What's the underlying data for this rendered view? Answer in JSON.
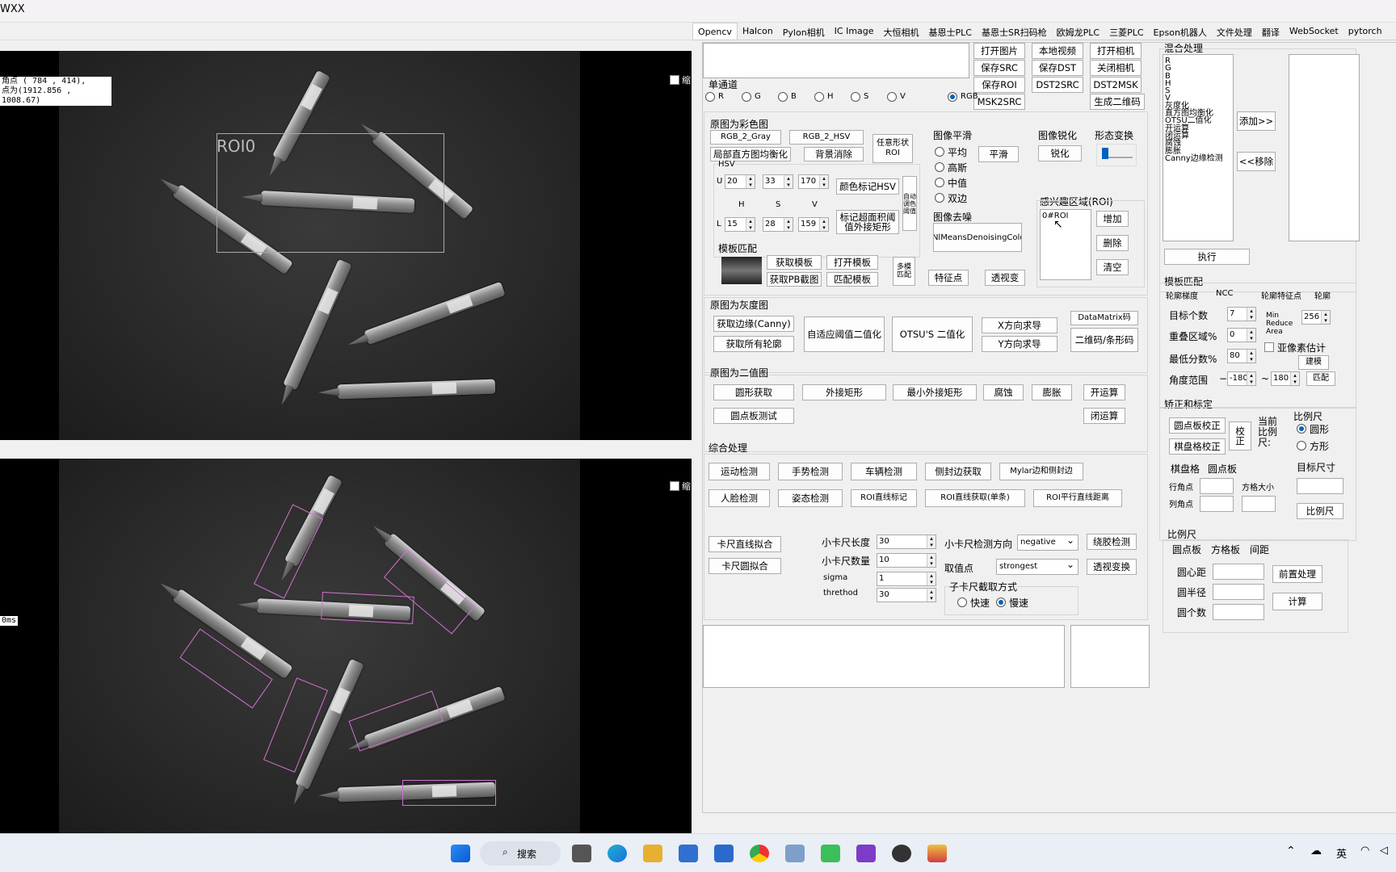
{
  "window": {
    "title": "WXX"
  },
  "left": {
    "top_view": {
      "overlay_lines": [
        "角点 ( 784 , 414),",
        "点为(1912.856 , 1008.67)"
      ],
      "roi_label": "ROI0",
      "checkbox_label": "缩"
    },
    "bottom_view": {
      "overlay_text": "0ms",
      "checkbox_label": "缩"
    }
  },
  "tabs": [
    "Opencv",
    "Halcon",
    "Pylon相机",
    "IC Image",
    "大恒相机",
    "基恩士PLC",
    "基恩士SR扫码枪",
    "欧姆龙PLC",
    "三菱PLC",
    "Epson机器人",
    "文件处理",
    "翻译",
    "WebSocket",
    "pytorch"
  ],
  "file_buttons": {
    "open_image": "打开图片",
    "local_video": "本地视频",
    "open_camera": "打开相机",
    "save_src": "保存SRC",
    "save_dst": "保存DST",
    "close_camera": "关闭相机",
    "save_roi": "保存ROI",
    "dst2src": "DST2SRC",
    "dst2msk": "DST2MSK",
    "msk2src": "MSK2SRC",
    "gen_qr": "生成二维码"
  },
  "channel": {
    "title": "单通道",
    "options": [
      "R",
      "G",
      "B",
      "H",
      "S",
      "V",
      "RGB"
    ],
    "selected": "RGB"
  },
  "color_section": {
    "title": "原图为彩色图",
    "rgb2gray": "RGB_2_Gray",
    "rgb2hsv": "RGB_2_HSV",
    "any_roi": "任意形状ROI",
    "local_hist": "局部直方图均衡化",
    "bg_remove": "背景消除",
    "hsv_title": "HSV",
    "u_label": "U",
    "l_label": "L",
    "h_label": "H",
    "s_label": "S",
    "v_label": "V",
    "u_vals": [
      "20",
      "33",
      "170"
    ],
    "l_vals": [
      "15",
      "28",
      "159"
    ],
    "color_mark": "颜色标记HSV",
    "mark_rect": "标记超面积阈值外接矩形",
    "vertical_btn": "自动调色阈值",
    "template_title": "模板匹配",
    "get_template": "获取模板",
    "open_template": "打开模板",
    "get_pb": "获取PB截图",
    "match_template": "匹配模板",
    "multi_match": "多模匹配",
    "smooth_title": "图像平滑",
    "smooth_opts": [
      "平均",
      "高斯",
      "中值",
      "双边"
    ],
    "smooth_btn": "平滑",
    "denoise_title": "图像去噪",
    "denoise_btn": "fastNlMeansDenoisingColored",
    "feature_pt": "特征点",
    "perspective": "透视变",
    "sharpen_title": "图像锐化",
    "sharpen_btn": "锐化",
    "morph_title": "形态变换",
    "roi_title": "感兴趣区域(ROI)",
    "roi_items": [
      "0#ROI"
    ],
    "roi_add": "增加",
    "roi_del": "删除",
    "roi_clear": "清空"
  },
  "gray_section": {
    "title": "原图为灰度图",
    "canny": "获取边缘(Canny)",
    "all_contours": "获取所有轮廓",
    "adaptive": "自适应阈值二值化",
    "otsu": "OTSU'S 二值化",
    "xderiv": "X方向求导",
    "yderiv": "Y方向求导",
    "datamatrix": "DataMatrix码",
    "qr_bar": "二维码/条形码"
  },
  "binary_section": {
    "title": "原图为二值图",
    "circle": "圆形获取",
    "bound_rect": "外接矩形",
    "min_rect": "最小外接矩形",
    "erode": "腐蚀",
    "dilate": "膨胀",
    "open": "开运算",
    "dot_test": "圆点板测试",
    "close": "闭运算"
  },
  "general": {
    "title": "综合处理",
    "motion": "运动检测",
    "gesture": "手势检测",
    "vehicle": "车辆检测",
    "side_seal": "侧封边获取",
    "mylar": "Mylar边和侧封边",
    "face": "人脸检测",
    "pose": "姿态检测",
    "roi_line": "ROI直线标记",
    "roi_line_single": "ROI直线获取(单条)",
    "roi_parallel": "ROI平行直线距离",
    "caliper_line": "卡尺直线拟合",
    "caliper_circle": "卡尺圆拟合",
    "cal_len_label": "小卡尺长度",
    "cal_len": "30",
    "cal_num_label": "小卡尺数量",
    "cal_num": "10",
    "sigma_label": "sigma",
    "sigma": "1",
    "thr_label": "threthod",
    "thr": "30",
    "dir_label": "小卡尺检测方向",
    "dir_val": "negative",
    "pick_label": "取值点",
    "pick_val": "strongest",
    "glue": "绕胶检测",
    "persp": "透视变换",
    "sub_title": "子卡尺截取方式",
    "fast": "快速",
    "slow": "慢速"
  },
  "mix": {
    "title": "混合处理",
    "list": [
      "R",
      "G",
      "B",
      "H",
      "S",
      "V",
      "灰度化",
      "直方图均衡化",
      "OTSU二值化",
      "开运算",
      "闭运算",
      "腐蚀",
      "膨胀",
      "Canny边缘检测"
    ],
    "add": "添加>>",
    "remove": "<<移除",
    "exec": "执行"
  },
  "tmatch": {
    "title": "模板匹配",
    "tabs": [
      "轮廓梯度",
      "NCC",
      "轮廓特征点",
      "轮廓"
    ],
    "count_label": "目标个数",
    "count": "7",
    "min_reduce": "Min Reduce Area",
    "min_reduce_val": "256",
    "overlap_label": "重叠区域%",
    "overlap": "0",
    "subpixel": "亚像素估计",
    "score_label": "最低分数%",
    "score": "80",
    "build": "建模",
    "angle_label": "角度范围",
    "angle_from": "-180",
    "tilde": "~",
    "angle_to": "180",
    "match": "匹配"
  },
  "calib": {
    "title": "矫正和标定",
    "dot_calib": "圆点板校正",
    "chess_calib": "棋盘格校正",
    "correct": "校正",
    "cur_ratio": "当前比例尺:",
    "scale_title": "比例尺",
    "circle": "圆形",
    "square": "方形",
    "target_size": "目标尺寸",
    "ratio_btn": "比例尺",
    "tab_chess": "棋盘格",
    "tab_dot": "圆点板",
    "row_label": "行角点",
    "col_label": "列角点",
    "grid_size": "方格大小"
  },
  "scale": {
    "title": "比例尺",
    "tabs": [
      "圆点板",
      "方格板",
      "间距"
    ],
    "center_dist": "圆心距",
    "radius": "圆半径",
    "count": "圆个数",
    "pre": "前置处理",
    "calc": "计算"
  },
  "taskbar": {
    "search": "搜索",
    "ime": "英"
  }
}
